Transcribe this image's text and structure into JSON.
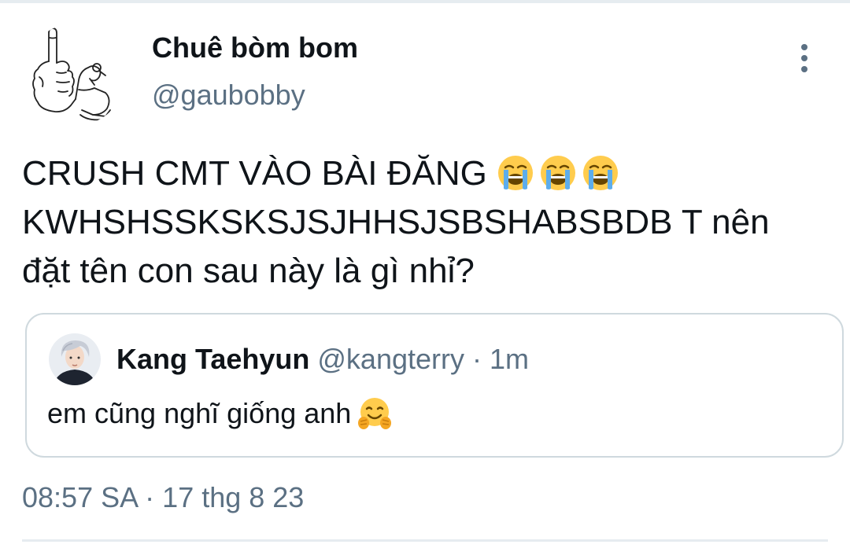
{
  "author": {
    "display_name": "Chuê bòm bom",
    "handle": "@gaubobby"
  },
  "tweet": {
    "text_line1": "CRUSH CMT VÀO BÀI ĐĂNG",
    "text_line2": "KWHSHSSKSKSJSJHHSJSBSHABSBDB T nên",
    "text_line3": "đặt tên con sau này là gì nhỉ?",
    "emojis": [
      "loudly-crying-face",
      "loudly-crying-face",
      "loudly-crying-face"
    ]
  },
  "quoted_tweet": {
    "display_name": "Kang Taehyun",
    "handle": "@kangterry",
    "separator": "·",
    "time": "1m",
    "text": "em cũng nghĩ giống anh",
    "emoji": "hugging-face"
  },
  "meta": {
    "time": "08:57 SA",
    "separator": "·",
    "date": "17 thg 8 23"
  },
  "colors": {
    "text_primary": "#0f1419",
    "text_secondary": "#5b7083",
    "border": "#cfd9de",
    "divider": "#e6ecf0"
  }
}
